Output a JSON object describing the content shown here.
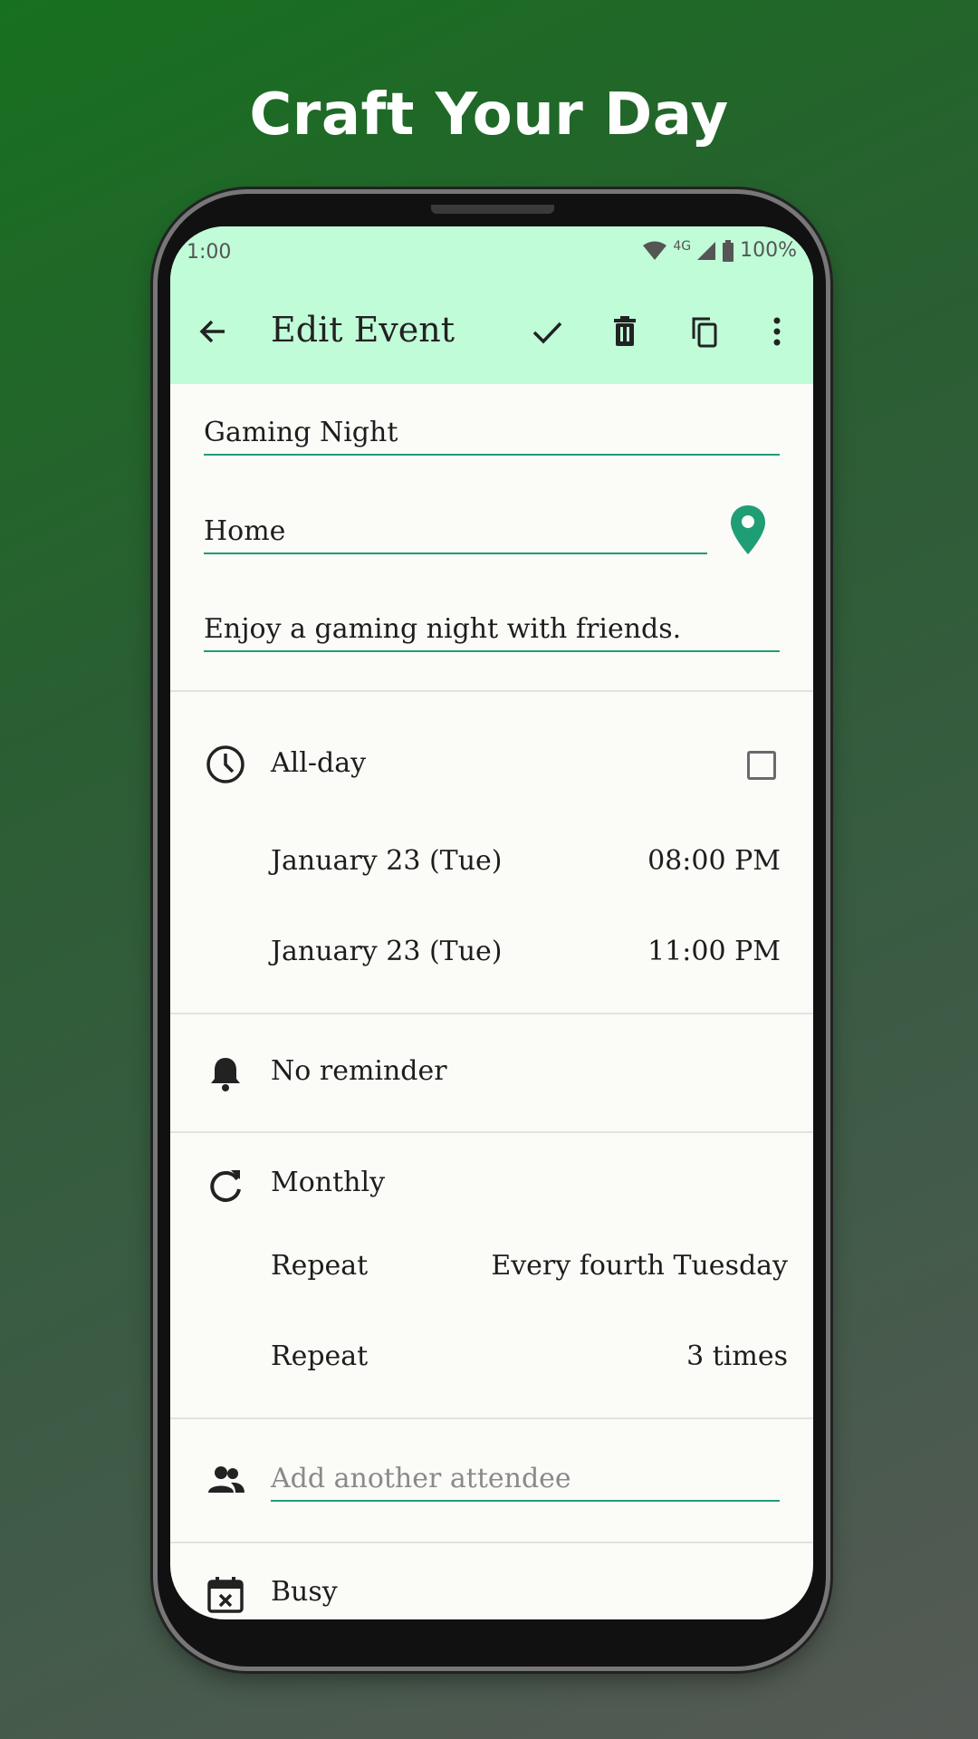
{
  "headline": "Craft Your Day",
  "status_bar": {
    "time": "1:00",
    "network": "4G",
    "battery": "100%"
  },
  "app_bar": {
    "title": "Edit Event"
  },
  "event": {
    "title": "Gaming Night",
    "location": "Home",
    "description": "Enjoy a gaming night with friends."
  },
  "time_section": {
    "all_day_label": "All-day",
    "start_date": "January 23 (Tue)",
    "start_time": "08:00 PM",
    "end_date": "January 23 (Tue)",
    "end_time": "11:00 PM"
  },
  "reminder": {
    "label": "No reminder"
  },
  "repeat": {
    "frequency": "Monthly",
    "rule_label": "Repeat",
    "rule_value": "Every fourth Tuesday",
    "count_label": "Repeat",
    "count_value": "3 times"
  },
  "attendees": {
    "placeholder": "Add another attendee"
  },
  "availability": {
    "label": "Busy"
  },
  "colors": {
    "accent": "#1f9e75",
    "app_bar": "#c0fcd8",
    "location_pin": "#1f9e75"
  }
}
